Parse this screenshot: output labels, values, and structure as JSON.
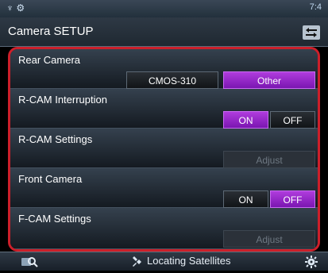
{
  "app": {
    "title": "Camera SETUP"
  },
  "status_bar": {
    "left_icons": "♆ ⚙",
    "right_text": "7:4"
  },
  "rows": {
    "rear_camera": {
      "label": "Rear Camera",
      "options": [
        "CMOS-310",
        "Other"
      ],
      "selected": "Other"
    },
    "r_cam_interruption": {
      "label": "R-CAM Interruption",
      "on_label": "ON",
      "off_label": "OFF",
      "selected": "ON"
    },
    "r_cam_settings": {
      "label": "R-CAM Settings",
      "button_label": "Adjust"
    },
    "front_camera": {
      "label": "Front Camera",
      "on_label": "ON",
      "off_label": "OFF",
      "selected": "OFF"
    },
    "f_cam_settings": {
      "label": "F-CAM Settings",
      "button_label": "Adjust"
    }
  },
  "bottom_bar": {
    "status": "Locating Satellites"
  },
  "icons": {
    "back": "back-icon",
    "search": "search-icon",
    "gps": "satellite-icon",
    "settings": "gear-icon"
  }
}
